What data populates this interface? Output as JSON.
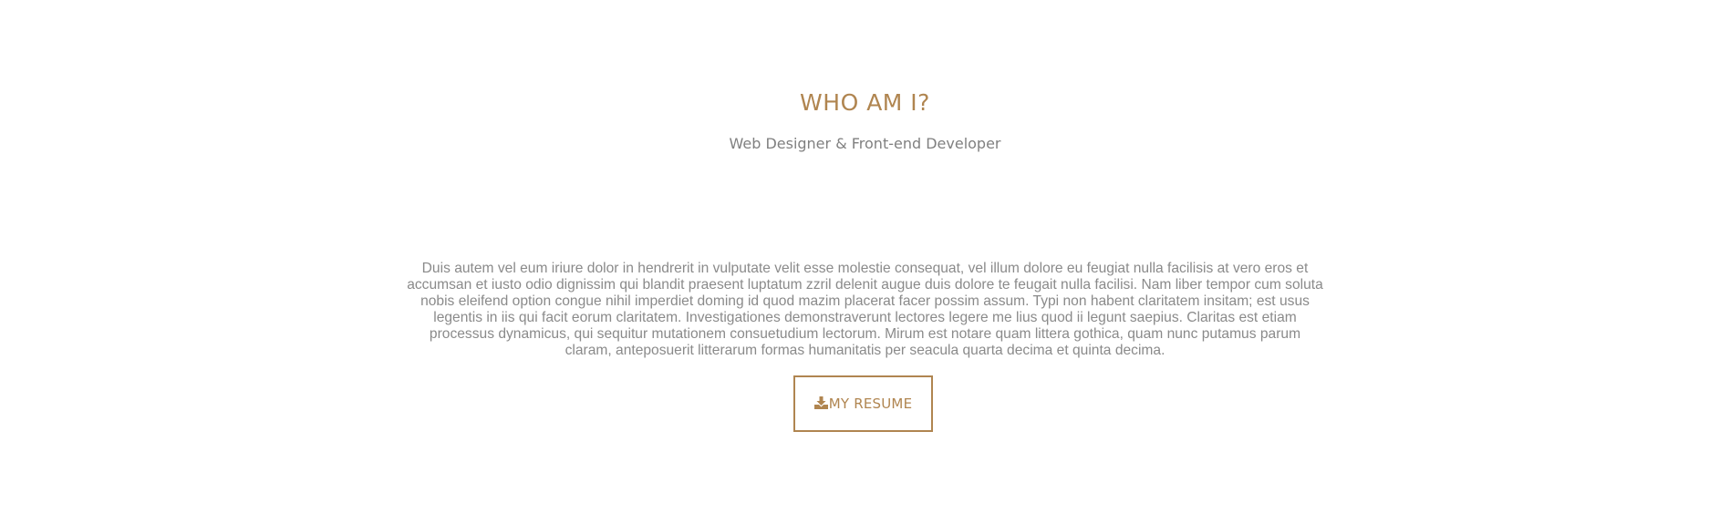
{
  "about": {
    "title": "WHO AM I?",
    "subtitle": "Web Designer & Front-end Developer",
    "bio": "Duis autem vel eum iriure dolor in hendrerit in vulputate velit esse molestie consequat, vel illum dolore eu feugiat nulla facilisis at vero eros et accumsan et iusto odio dignissim qui blandit praesent luptatum zzril delenit augue duis dolore te feugait nulla facilisi. Nam liber tempor cum soluta nobis eleifend option congue nihil imperdiet doming id quod mazim placerat facer possim assum. Typi non habent claritatem insitam; est usus legentis in iis qui facit eorum claritatem. Investigationes demonstraverunt lectores legere me lius quod ii legunt saepius. Claritas est etiam processus dynamicus, qui sequitur mutationem consuetudium lectorum. Mirum est notare quam littera gothica, quam nunc putamus parum claram, anteposuerit litterarum formas humanitatis per seacula quarta decima et quinta decima.",
    "resume_button": {
      "label": "MY RESUME",
      "icon": "download-icon"
    }
  },
  "colors": {
    "accent": "#b08550",
    "text_muted": "#8a8a8a",
    "background": "#ffffff"
  }
}
